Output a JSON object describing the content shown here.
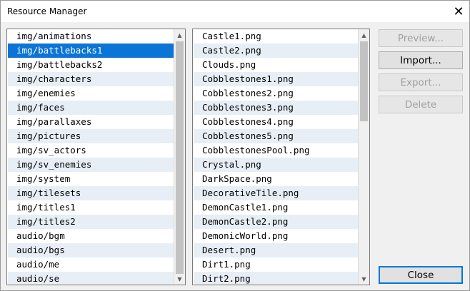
{
  "window": {
    "title": "Resource Manager",
    "close_glyph": "✕"
  },
  "folders": {
    "selected_index": 1,
    "items": [
      "img/animations",
      "img/battlebacks1",
      "img/battlebacks2",
      "img/characters",
      "img/enemies",
      "img/faces",
      "img/parallaxes",
      "img/pictures",
      "img/sv_actors",
      "img/sv_enemies",
      "img/system",
      "img/tilesets",
      "img/titles1",
      "img/titles2",
      "audio/bgm",
      "audio/bgs",
      "audio/me",
      "audio/se"
    ]
  },
  "files": {
    "items": [
      "Castle1.png",
      "Castle2.png",
      "Clouds.png",
      "Cobblestones1.png",
      "Cobblestones2.png",
      "Cobblestones3.png",
      "Cobblestones4.png",
      "Cobblestones5.png",
      "CobblestonesPool.png",
      "Crystal.png",
      "DarkSpace.png",
      "DecorativeTile.png",
      "DemonCastle1.png",
      "DemonCastle2.png",
      "DemonicWorld.png",
      "Desert.png",
      "Dirt1.png",
      "Dirt2.png"
    ]
  },
  "buttons": {
    "preview": "Preview...",
    "import": "Import...",
    "export": "Export...",
    "delete": "Delete",
    "close": "Close"
  },
  "icons": {
    "scroll_up": "scroll-up-arrow-icon",
    "scroll_down": "scroll-down-arrow-icon",
    "close": "close-icon"
  }
}
